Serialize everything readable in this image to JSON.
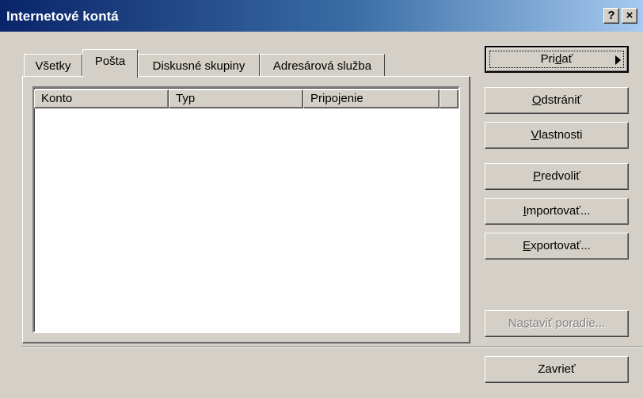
{
  "window": {
    "title": "Internetové kontá",
    "help_glyph": "?",
    "close_glyph": "×"
  },
  "tabs": [
    {
      "label": "Všetky",
      "active": false
    },
    {
      "label": "Pošta",
      "active": true
    },
    {
      "label": "Diskusné skupiny",
      "active": false
    },
    {
      "label": "Adresárová služba",
      "active": false
    }
  ],
  "list": {
    "columns": [
      "Konto",
      "Typ",
      "Pripojenie"
    ],
    "rows": []
  },
  "buttons": {
    "add": {
      "pre": "Pri",
      "key": "d",
      "post": "ať"
    },
    "remove": {
      "pre": "",
      "key": "O",
      "post": "dstrániť"
    },
    "properties": {
      "pre": "",
      "key": "V",
      "post": "lastnosti"
    },
    "default": {
      "pre": "",
      "key": "P",
      "post": "redvoliť"
    },
    "import": {
      "pre": "",
      "key": "I",
      "post": "mportovať..."
    },
    "export": {
      "pre": "",
      "key": "E",
      "post": "xportovať..."
    },
    "order": {
      "pre": "Na",
      "key": "s",
      "post": "taviť poradie..."
    },
    "close": {
      "label": "Zavrieť"
    }
  }
}
